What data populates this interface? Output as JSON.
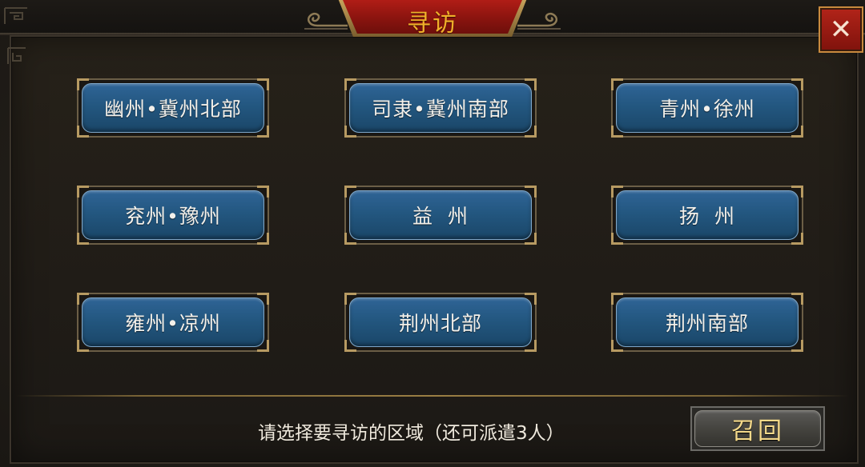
{
  "dialog": {
    "title": "寻访",
    "close_label": "✕"
  },
  "regions": [
    {
      "label": "幽州•冀州北部"
    },
    {
      "label": "司隶•冀州南部"
    },
    {
      "label": "青州•徐州"
    },
    {
      "label": "兖州•豫州"
    },
    {
      "label": "益  州"
    },
    {
      "label": "扬  州"
    },
    {
      "label": "雍州•凉州"
    },
    {
      "label": "荆州北部"
    },
    {
      "label": "荆州南部"
    }
  ],
  "footer": {
    "hint": "请选择要寻访的区域（还可派遣3人）",
    "recall_label": "召回"
  },
  "colors": {
    "title_text": "#f0b12a",
    "title_tab": "#9b1912",
    "region_button": "#235780",
    "recall_text": "#f4d98a",
    "close_button": "#a01c14"
  }
}
